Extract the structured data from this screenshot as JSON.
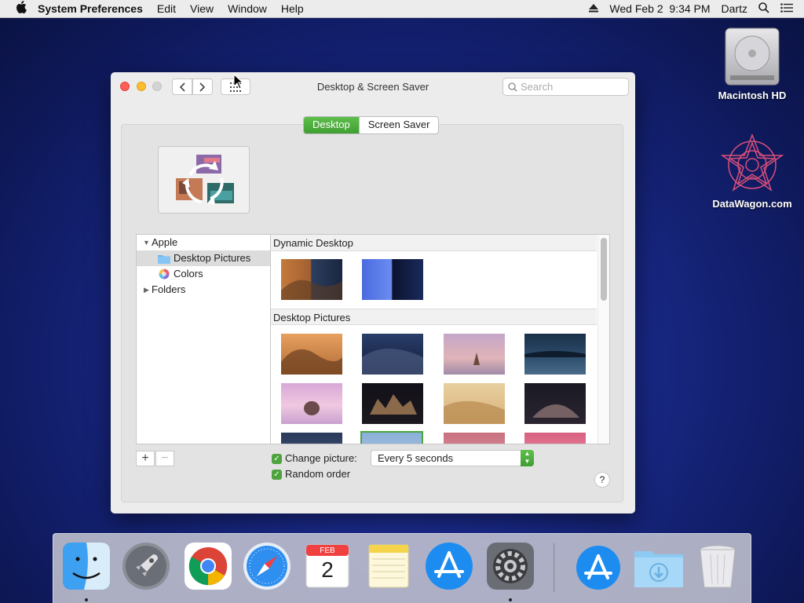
{
  "menubar": {
    "app": "System Preferences",
    "menus": [
      "Edit",
      "View",
      "Window",
      "Help"
    ],
    "clock": "Wed Feb 2  9:34 PM",
    "user": "Dartz"
  },
  "desktop": {
    "icons": [
      {
        "label": "Macintosh HD"
      },
      {
        "label": "DataWagon.com"
      }
    ]
  },
  "window": {
    "title": "Desktop & Screen Saver",
    "search_placeholder": "Search",
    "tabs": [
      {
        "label": "Desktop",
        "selected": true
      },
      {
        "label": "Screen Saver",
        "selected": false
      }
    ],
    "sources": [
      {
        "label": "Apple",
        "level": 0,
        "expanded": true
      },
      {
        "label": "Desktop Pictures",
        "level": 1,
        "selected": true
      },
      {
        "label": "Colors",
        "level": 1
      },
      {
        "label": "Folders",
        "level": 0,
        "expanded": false
      }
    ],
    "sections": [
      {
        "title": "Dynamic Desktop"
      },
      {
        "title": "Desktop Pictures"
      }
    ],
    "change_picture": {
      "label": "Change picture:",
      "checked": true,
      "value": "Every 5 seconds"
    },
    "random_order": {
      "label": "Random order",
      "checked": true
    },
    "add_label": "+",
    "remove_label": "−",
    "help_label": "?"
  },
  "dock": {
    "apps": [
      "Finder",
      "Launchpad",
      "Google Chrome",
      "Safari",
      "Calendar",
      "Notes",
      "App Store",
      "System Preferences",
      "Downloads App Store",
      "Downloads",
      "Trash"
    ],
    "calendar_month": "FEB",
    "calendar_day": "2"
  },
  "colors": {
    "accent_green": "#4ea33f",
    "window_bg": "#ececec"
  }
}
